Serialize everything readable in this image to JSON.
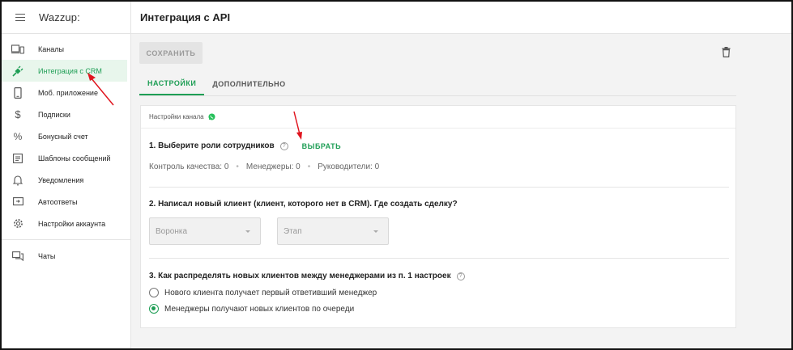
{
  "app": {
    "brand": "Wazzup:"
  },
  "sidebar": {
    "items": [
      {
        "label": "Каналы",
        "icon": "devices-icon"
      },
      {
        "label": "Интеграция с CRM",
        "icon": "plug-icon",
        "active": true
      },
      {
        "label": "Моб. приложение",
        "icon": "phone-icon"
      },
      {
        "label": "Подписки",
        "icon": "dollar-icon"
      },
      {
        "label": "Бонусный счет",
        "icon": "percent-icon"
      },
      {
        "label": "Шаблоны сообщений",
        "icon": "template-icon"
      },
      {
        "label": "Уведомления",
        "icon": "bell-icon"
      },
      {
        "label": "Автоответы",
        "icon": "autoreply-icon"
      },
      {
        "label": "Настройки аккаунта",
        "icon": "gear-icon"
      },
      {
        "label": "Чаты",
        "icon": "chats-icon"
      }
    ]
  },
  "header": {
    "title": "Интеграция с API"
  },
  "toolbar": {
    "save_label": "СОХРАНИТЬ"
  },
  "tabs": [
    {
      "label": "НАСТРОЙКИ",
      "active": true
    },
    {
      "label": "ДОПОЛНИТЕЛЬНО",
      "active": false
    }
  ],
  "card": {
    "title": "Настройки канала",
    "section1": {
      "question": "1. Выберите роли сотрудников",
      "help": "?",
      "pick_label": "ВЫБРАТЬ",
      "counts": [
        {
          "text": "Контроль качества: 0"
        },
        {
          "text": "Менеджеры: 0"
        },
        {
          "text": "Руководители: 0"
        }
      ]
    },
    "section2": {
      "question": "2. Написал новый клиент (клиент, которого нет в CRM). Где создать сделку?",
      "funnel_placeholder": "Воронка",
      "stage_placeholder": "Этап"
    },
    "section3": {
      "question": "3. Как распределять новых клиентов между менеджерами из п. 1 настроек",
      "help": "?",
      "options": [
        {
          "label": "Нового клиента получает первый ответивший менеджер",
          "selected": false
        },
        {
          "label": "Менеджеры получают новых клиентов по очереди",
          "selected": true
        }
      ]
    }
  },
  "colors": {
    "accent": "#1e9e55",
    "annotation_arrow": "#e0141e"
  }
}
